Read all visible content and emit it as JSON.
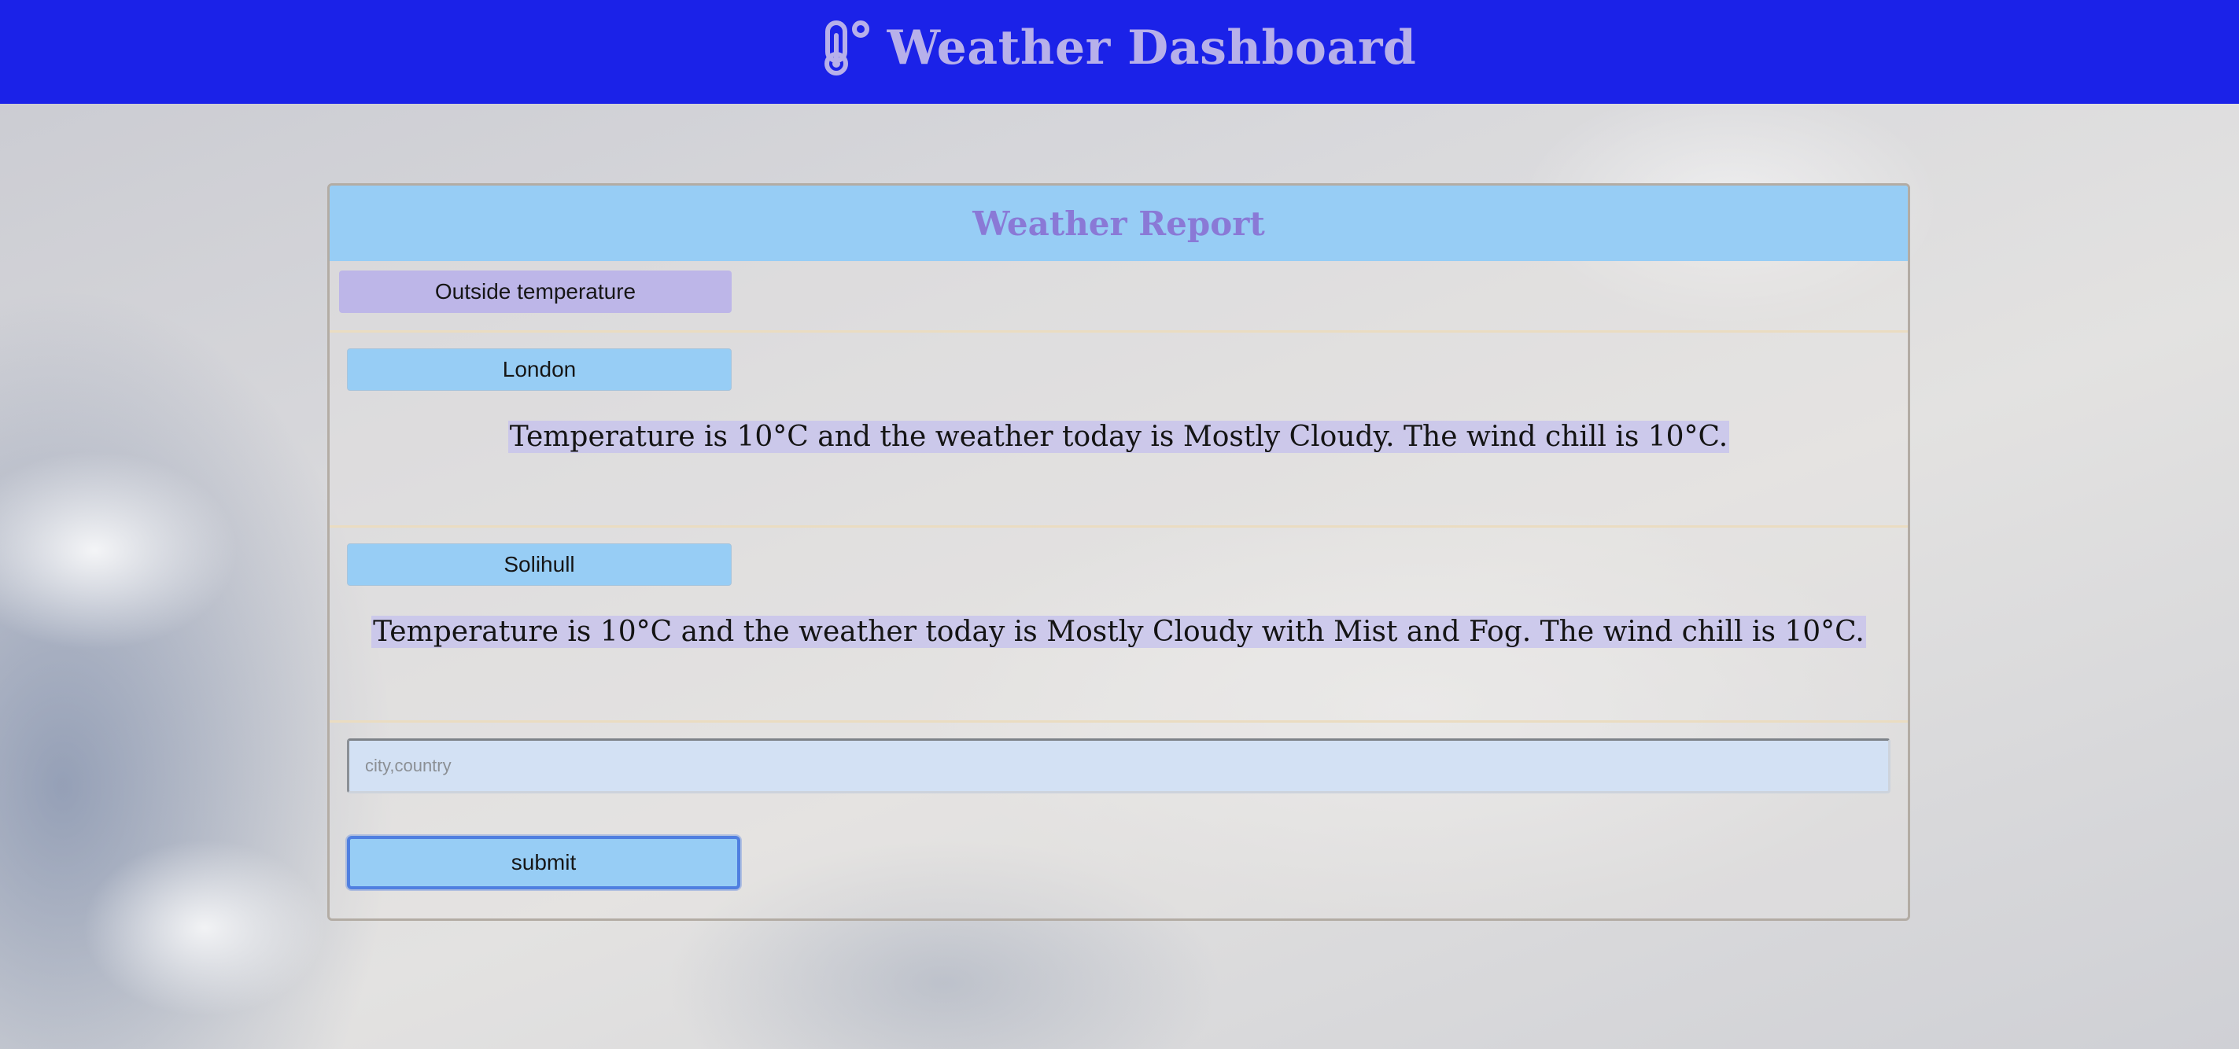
{
  "header": {
    "icon": "thermometer-icon",
    "title": "Weather Dashboard"
  },
  "report": {
    "title": "Weather Report",
    "outside_label": "Outside temperature",
    "cities": [
      {
        "name": "London",
        "description": "Temperature is 10°C and the weather today is Mostly Cloudy. The wind chill is 10°C."
      },
      {
        "name": "Solihull",
        "description": "Temperature is 10°C and the weather today is Mostly Cloudy with Mist and Fog. The wind chill is 10°C."
      }
    ]
  },
  "form": {
    "input_value": "",
    "placeholder": "city,country",
    "submit_label": "submit"
  },
  "colors": {
    "header_bg": "#1b22e8",
    "header_text": "#b7b0ea",
    "panel_head_bg": "#97cdf5",
    "panel_title": "#8a79d6",
    "outside_label_bg": "#bdb6e8",
    "city_button_bg": "#97cdf5",
    "report_highlight": "#c4c0ee",
    "submit_border": "#4f7fe0"
  }
}
